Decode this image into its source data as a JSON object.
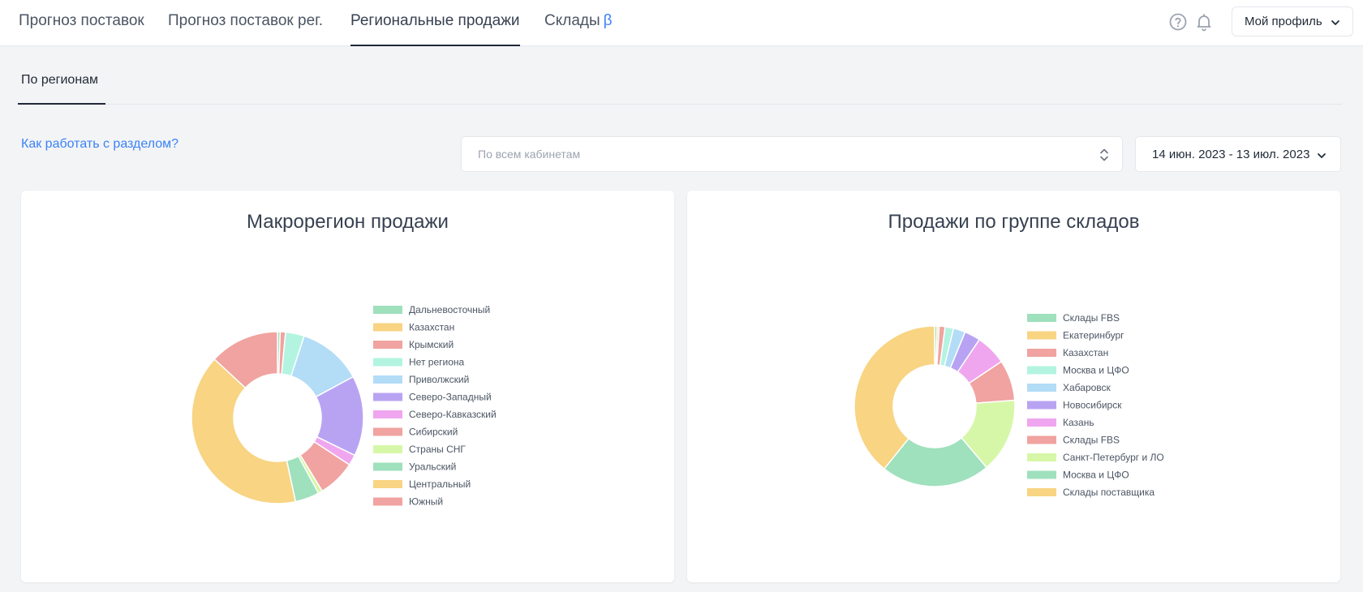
{
  "nav": {
    "tabs": [
      {
        "label": "Прогноз поставок"
      },
      {
        "label": "Прогноз поставок рег."
      },
      {
        "label": "Региональные продажи"
      },
      {
        "label": "Склады"
      }
    ],
    "beta_mark": "β",
    "profile_label": "Мой профиль"
  },
  "subtabs": {
    "active_label": "По регионам"
  },
  "filters": {
    "help_link": "Как работать с разделом?",
    "cabinet_placeholder": "По всем кабинетам",
    "date_range": "14 июн. 2023 - 13 июл. 2023"
  },
  "chart_data": [
    {
      "type": "pie",
      "variant": "donut",
      "title": "Макрорегион продажи",
      "legend_position": "right",
      "labels": [
        "Дальневосточный",
        "Казахстан",
        "Крымский",
        "Нет региона",
        "Приволжский",
        "Северо-Западный",
        "Северо-Кавказский",
        "Сибирский",
        "Страны СНГ",
        "Уральский",
        "Центральный",
        "Южный"
      ],
      "values": [
        0.5,
        0,
        1,
        3.5,
        12,
        15,
        2,
        7,
        0.8,
        4.5,
        40,
        13
      ],
      "colors": [
        "#9fe0bd",
        "#f8d483",
        "#f0a3a0",
        "#b3f4e1",
        "#b3dcf7",
        "#b8a3f3",
        "#efa6ef",
        "#f0a3a0",
        "#d7f7a8",
        "#9fe0bd",
        "#f8d483",
        "#f0a3a0"
      ]
    },
    {
      "type": "pie",
      "variant": "donut",
      "title": "Продажи по группе складов",
      "legend_position": "right",
      "labels": [
        "Склады FBS",
        "Екатеринбург",
        "Казахстан",
        "Москва и ЦФО",
        "Хабаровск",
        "Новосибирск",
        "Казань",
        "Склады FBS",
        "Санкт-Петербург и ЛО",
        "Москва и ЦФО",
        "Склады поставщика"
      ],
      "values": [
        0.5,
        0.4,
        1.2,
        1.7,
        2.4,
        3.2,
        6.2,
        8.2,
        15,
        22,
        39.2
      ],
      "colors": [
        "#9fe0bd",
        "#f8d483",
        "#f0a3a0",
        "#b3f4e1",
        "#b3dcf7",
        "#b8a3f3",
        "#efa6ef",
        "#f0a3a0",
        "#d7f7a8",
        "#9fe0bd",
        "#f8d483"
      ]
    }
  ]
}
